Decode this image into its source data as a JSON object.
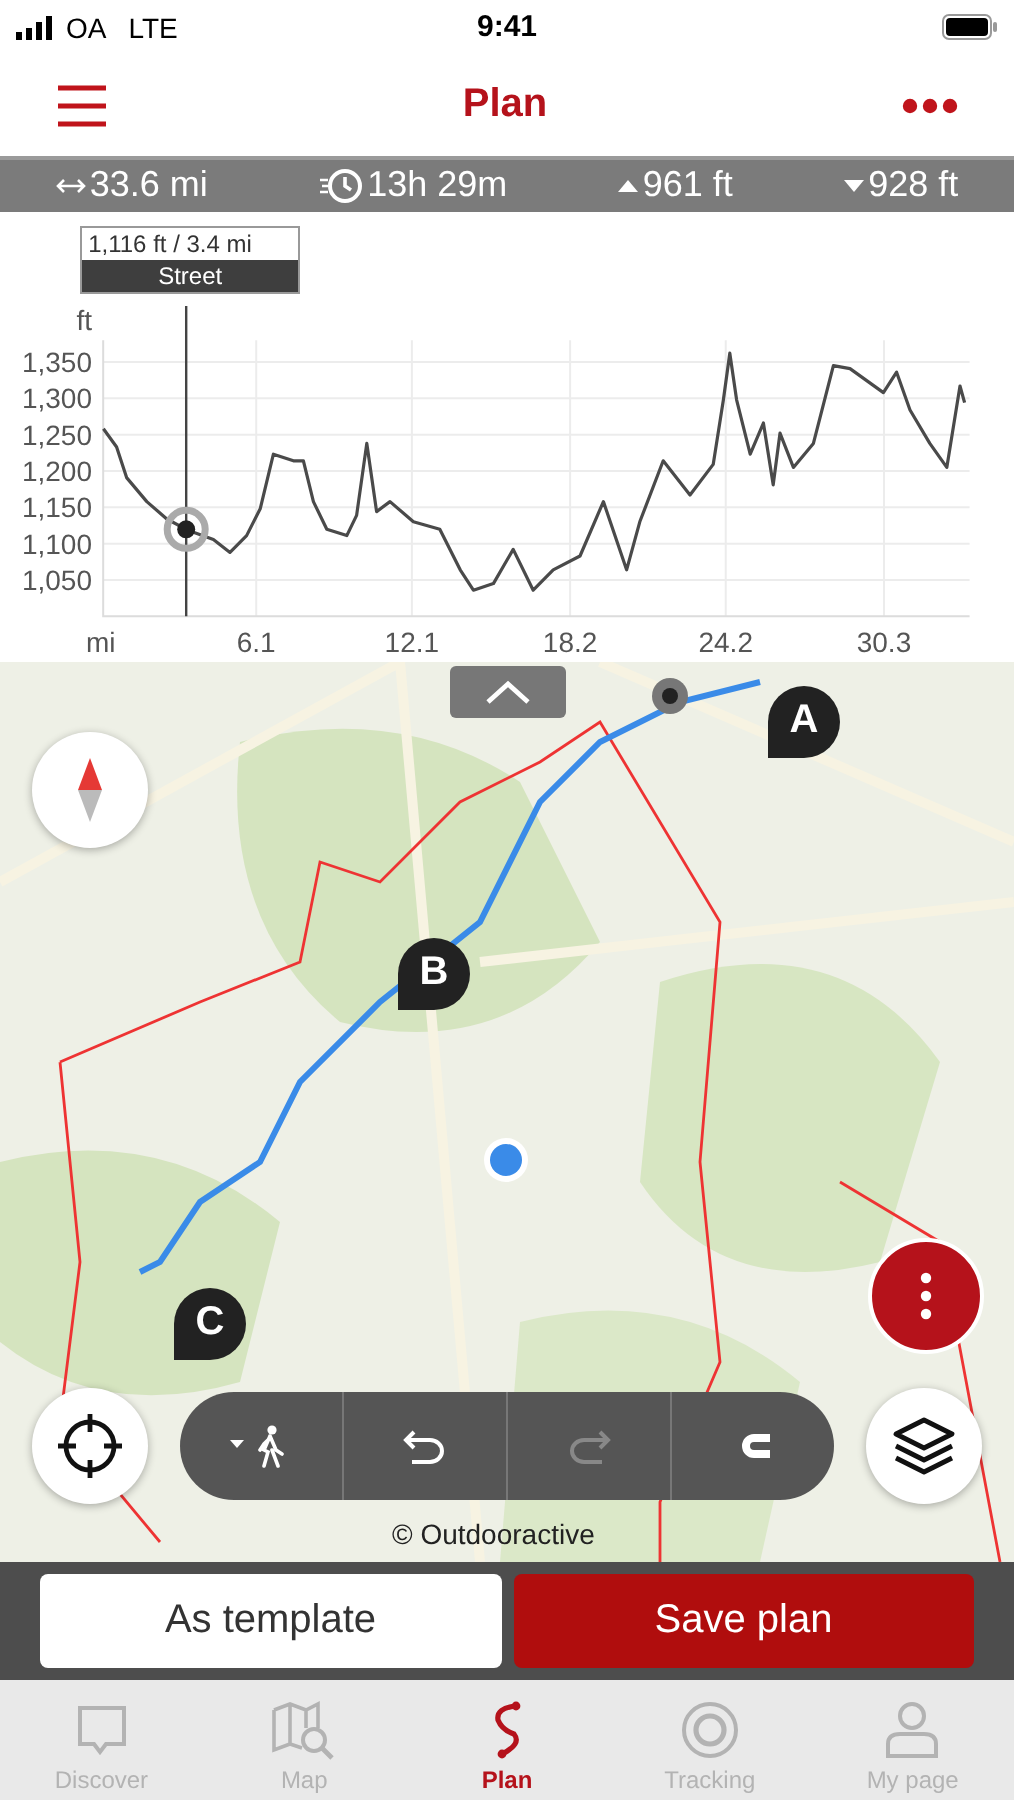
{
  "status_bar": {
    "carrier": "OA",
    "network": "LTE",
    "time": "9:41"
  },
  "header": {
    "title": "Plan"
  },
  "stats": [
    {
      "kind": "distance",
      "value": "33.6 mi"
    },
    {
      "kind": "duration",
      "value": "13h 29m"
    },
    {
      "kind": "ascent",
      "value": "961 ft"
    },
    {
      "kind": "descent",
      "value": "928 ft"
    }
  ],
  "elevation_profile": {
    "surface": "Street",
    "chart_data": {
      "type": "line",
      "grid": true,
      "xlabel": "mi",
      "ylabel": "ft",
      "xlim": [
        0.2,
        33.6
      ],
      "ylim": [
        1000,
        1380
      ],
      "xticks": [
        6.1,
        12.1,
        18.2,
        24.2,
        30.3
      ],
      "yticks": [
        {
          "value": 1050,
          "label": "1,050"
        },
        {
          "value": 1100,
          "label": "1,100"
        },
        {
          "value": 1150,
          "label": "1,150"
        },
        {
          "value": 1200,
          "label": "1,200"
        },
        {
          "value": 1250,
          "label": "1,250"
        },
        {
          "value": 1300,
          "label": "1,300"
        },
        {
          "value": 1350,
          "label": "1,350"
        }
      ],
      "x": [
        0.21,
        0.72,
        1.1,
        1.88,
        2.65,
        3.49,
        4.45,
        5.09,
        5.73,
        6.25,
        6.76,
        7.53,
        7.92,
        8.3,
        8.82,
        9.59,
        9.97,
        10.36,
        10.74,
        11.26,
        12.16,
        13.18,
        13.96,
        14.47,
        15.24,
        16.01,
        16.78,
        17.55,
        18.58,
        19.48,
        20.38,
        20.89,
        21.79,
        22.82,
        23.72,
        24.11,
        24.36,
        24.62,
        25.14,
        25.65,
        26.03,
        26.29,
        26.81,
        27.58,
        28.35,
        28.99,
        30.28,
        30.79,
        31.3,
        32.07,
        32.72,
        33.23,
        33.41
      ],
      "series": [
        {
          "color": "#4a4a4a",
          "values": [
            1258,
            1233,
            1191,
            1158,
            1134,
            1118,
            1106,
            1088,
            1111,
            1148,
            1223,
            1214,
            1214,
            1158,
            1120,
            1111,
            1139,
            1238,
            1144,
            1158,
            1130,
            1120,
            1064,
            1036,
            1045,
            1092,
            1036,
            1064,
            1083,
            1158,
            1064,
            1130,
            1214,
            1167,
            1209,
            1298,
            1362,
            1298,
            1223,
            1266,
            1181,
            1252,
            1205,
            1238,
            1345,
            1341,
            1308,
            1336,
            1284,
            1238,
            1205,
            1317,
            1294
          ]
        }
      ],
      "ref_lines": [
        {
          "axis": "x",
          "value": 3.4,
          "color": "#444444"
        }
      ],
      "annotations": [
        "1,116 ft / 3.4 mi"
      ]
    }
  },
  "map": {
    "kind": "picture",
    "markers": [
      {
        "label": "A"
      },
      {
        "label": "B"
      },
      {
        "label": "C"
      }
    ],
    "attribution": "© Outdooractive"
  },
  "tools": [
    {
      "kind": "mode",
      "disabled": false
    },
    {
      "kind": "undo",
      "disabled": false
    },
    {
      "kind": "redo",
      "disabled": true
    },
    {
      "kind": "snap",
      "disabled": false
    }
  ],
  "actions": [
    {
      "kind": "secondary",
      "label": "As template"
    },
    {
      "kind": "primary",
      "label": "Save plan"
    }
  ],
  "tab_bar": [
    {
      "kind": "discover",
      "label": "Discover",
      "selected": false
    },
    {
      "kind": "map",
      "label": "Map",
      "selected": false
    },
    {
      "kind": "plan",
      "label": "Plan",
      "selected": true
    },
    {
      "kind": "tracking",
      "label": "Tracking",
      "selected": false
    },
    {
      "kind": "profile",
      "label": "My page",
      "selected": false
    }
  ]
}
